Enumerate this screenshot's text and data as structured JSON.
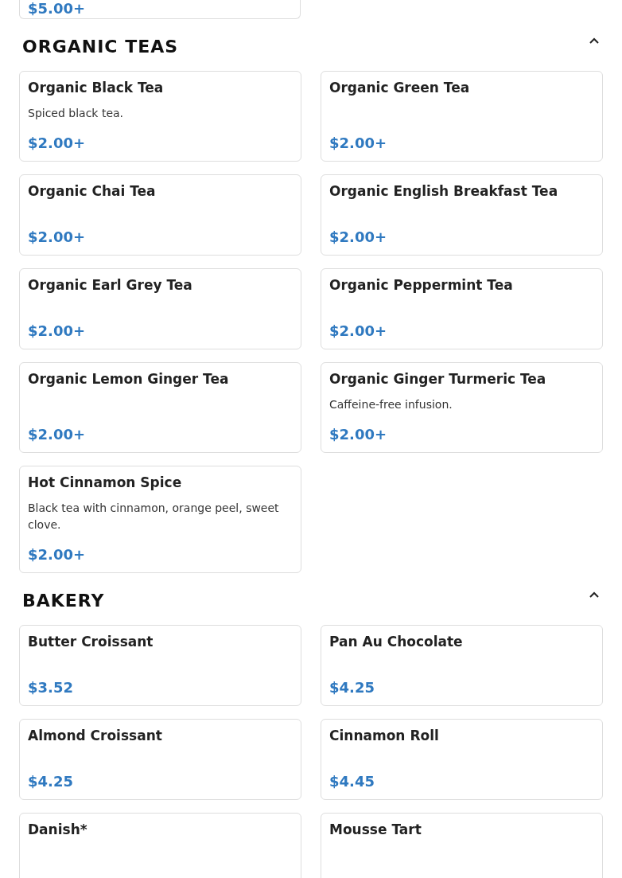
{
  "cut_off_item": {
    "price": "$5.00+"
  },
  "sections": [
    {
      "title": "ORGANIC TEAS",
      "expanded": true,
      "items": [
        {
          "name": "Organic Black Tea",
          "description": "Spiced black tea.",
          "price": "$2.00+"
        },
        {
          "name": "Organic Green Tea",
          "price": "$2.00+"
        },
        {
          "name": "Organic Chai Tea",
          "price": "$2.00+"
        },
        {
          "name": "Organic English Breakfast Tea",
          "price": "$2.00+"
        },
        {
          "name": "Organic Earl Grey Tea",
          "price": "$2.00+"
        },
        {
          "name": "Organic Peppermint Tea",
          "price": "$2.00+"
        },
        {
          "name": "Organic Lemon Ginger Tea",
          "price": "$2.00+"
        },
        {
          "name": "Organic Ginger Turmeric Tea",
          "description": "Caffeine-free infusion.",
          "price": "$2.00+"
        },
        {
          "name": "Hot Cinnamon Spice",
          "description": "Black tea with cinnamon, orange peel, sweet clove.",
          "price": "$2.00+"
        }
      ]
    },
    {
      "title": "BAKERY",
      "expanded": true,
      "items": [
        {
          "name": "Butter Croissant",
          "price": "$3.52"
        },
        {
          "name": "Pan Au Chocolate",
          "price": "$4.25"
        },
        {
          "name": "Almond Croissant",
          "price": "$4.25"
        },
        {
          "name": "Cinnamon Roll",
          "price": "$4.45"
        },
        {
          "name": "Danish*"
        },
        {
          "name": "Mousse Tart"
        }
      ]
    }
  ]
}
